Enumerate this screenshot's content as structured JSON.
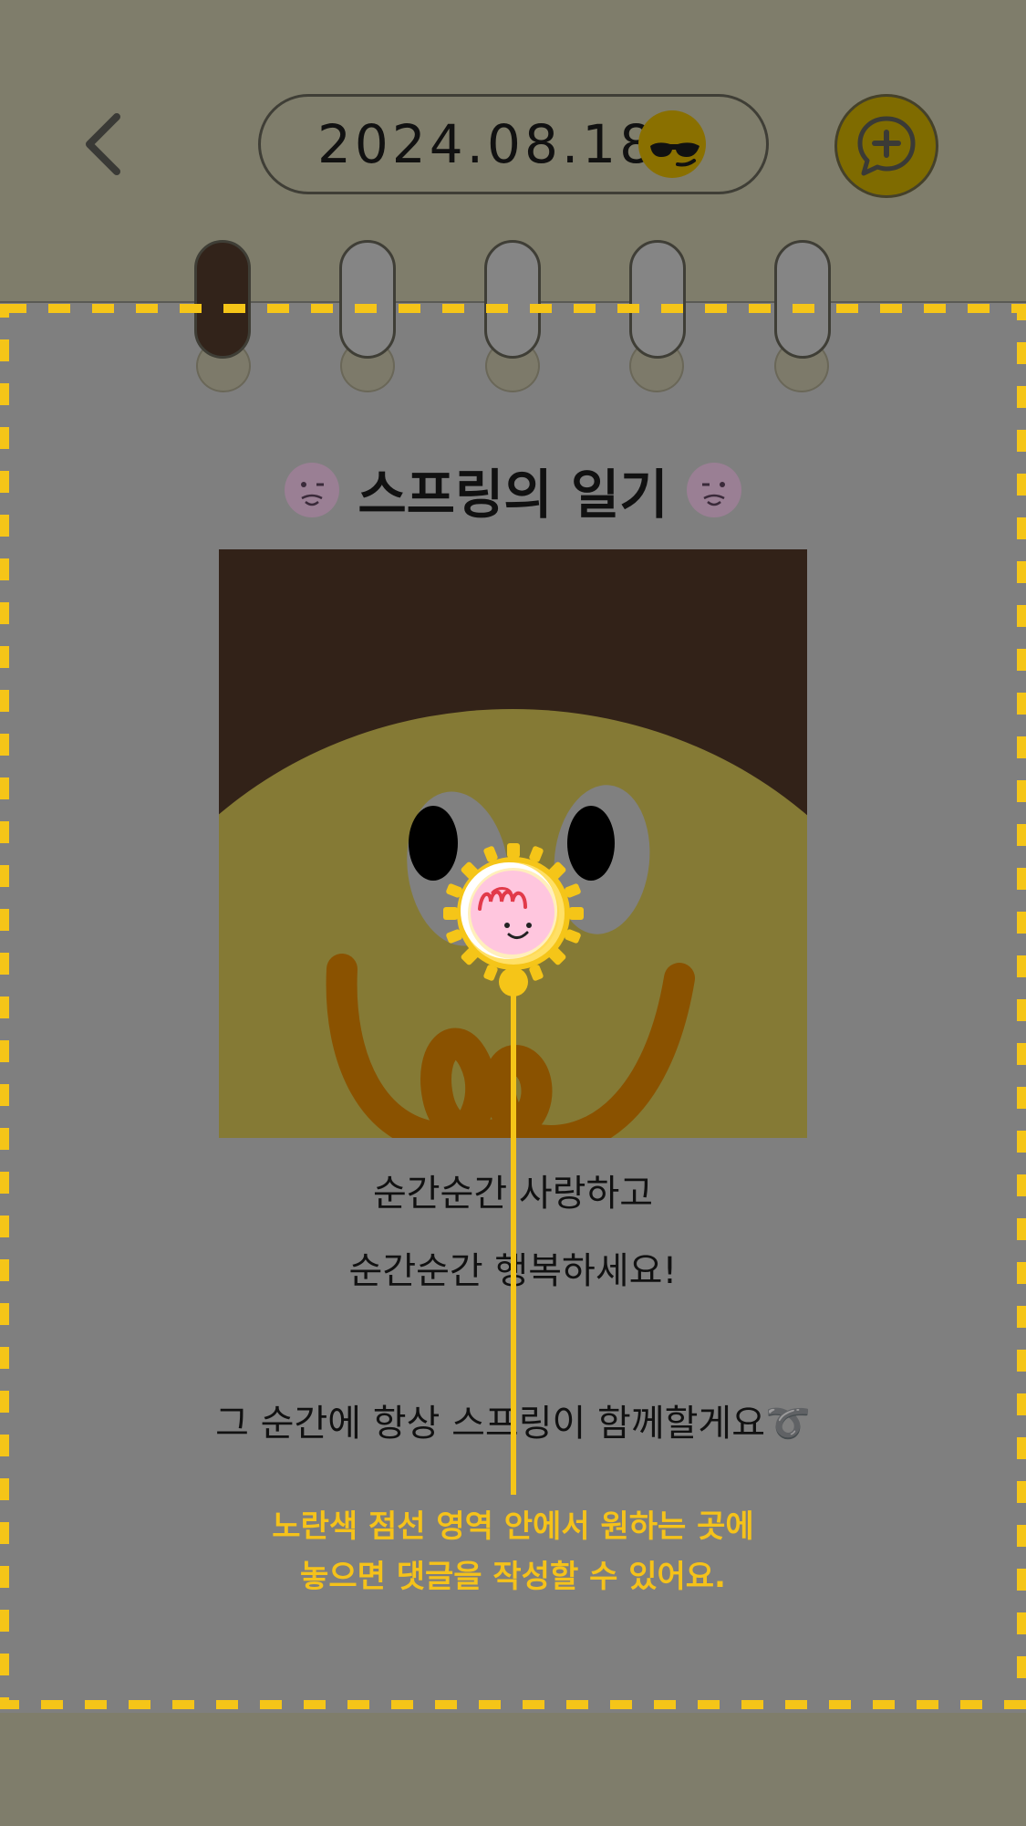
{
  "header": {
    "date": "2024.08.18",
    "back_icon": "chevron-left-icon",
    "mood_icon": "sunglasses-face-icon",
    "add_comment_icon": "chat-plus-icon"
  },
  "rings": {
    "count": 5,
    "active_index": 0
  },
  "diary": {
    "title": "스프링의 일기",
    "lines": [
      "순간순간 사랑하고",
      "순간순간 행복하세요!",
      ".",
      ".",
      "그 순간에 항상 스프링이 함께할게요➰"
    ]
  },
  "hint": {
    "line1": "노란색 점선 영역 안에서 원하는 곳에",
    "line2": "놓으면 댓글을 작성할 수 있어요."
  },
  "colors": {
    "background": "#7f7d6b",
    "paper": "#7f7f7f",
    "accent_yellow": "#f5c21a",
    "button_gold": "#7f6b00",
    "dark_brown": "#32231a"
  }
}
